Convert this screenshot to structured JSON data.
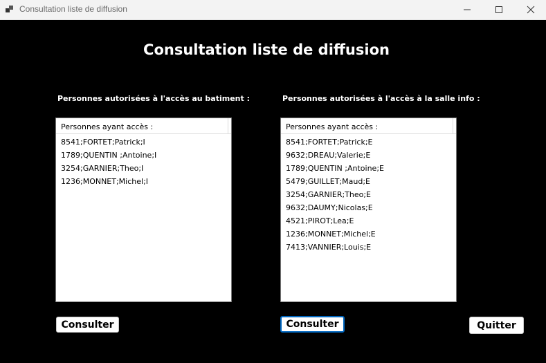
{
  "window": {
    "title": "Consultation liste de diffusion"
  },
  "heading": "Consultation liste de diffusion",
  "left_panel": {
    "label": "Personnes autorisées à l'accès au batiment :",
    "list_header": "Personnes ayant accès :",
    "rows": [
      "8541;FORTET;Patrick;I",
      "1789;QUENTIN ;Antoine;I",
      "3254;GARNIER;Theo;I",
      "1236;MONNET;Michel;I"
    ],
    "button": "Consulter"
  },
  "right_panel": {
    "label": "Personnes autorisées à l'accès à la salle info :",
    "list_header": "Personnes ayant accès :",
    "rows": [
      "8541;FORTET;Patrick;E",
      "9632;DREAU;Valerie;E",
      "1789;QUENTIN ;Antoine;E",
      "5479;GUILLET;Maud;E",
      "3254;GARNIER;Theo;E",
      "9632;DAUMY;Nicolas;E",
      "4521;PIROT;Lea;E",
      "1236;MONNET;Michel;E",
      "7413;VANNIER;Louis;E"
    ],
    "button": "Consulter"
  },
  "quit_button": "Quitter",
  "colors": {
    "background": "#000000",
    "titlebar": "#f3f3f3",
    "focus_border": "#0067c0"
  },
  "icons": {
    "app": "app-window-icon",
    "minimize": "minimize-icon",
    "maximize": "maximize-icon",
    "close": "close-icon"
  }
}
